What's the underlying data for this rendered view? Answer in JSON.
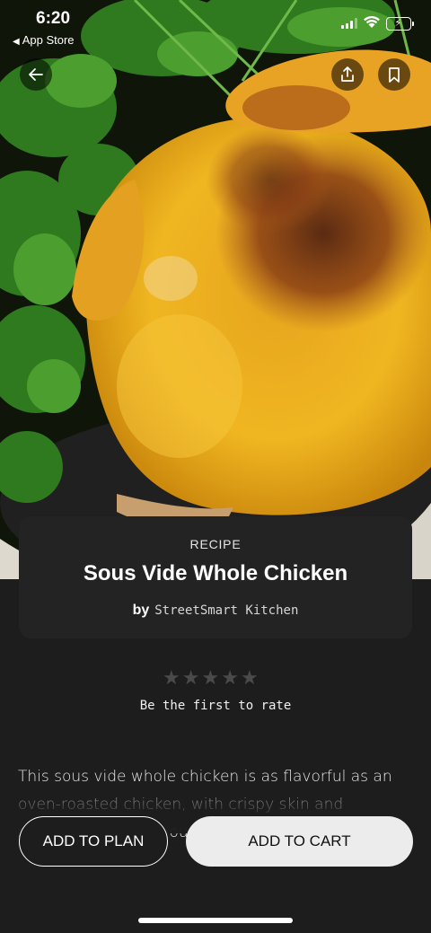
{
  "status_bar": {
    "time": "6:20",
    "back_to_app": "App Store"
  },
  "hero": {
    "image_subject": "roast-chicken-photo",
    "back_icon": "arrow-left-icon",
    "share_icon": "share-upload-icon",
    "save_icon": "bookmark-icon"
  },
  "recipe": {
    "kicker": "RECIPE",
    "title": "Sous Vide Whole Chicken",
    "by_label": "by",
    "author": "StreetSmart Kitchen"
  },
  "rating": {
    "stars_total": 5,
    "stars_filled": 0,
    "prompt": "Be the first to rate"
  },
  "description": {
    "text": "This sous vide whole chicken is as flavorful as an oven-roasted chicken, with crispy skin and succulent, melt-in-your-mouth meat throughout."
  },
  "actions": {
    "add_to_plan": "ADD TO PLAN",
    "add_to_cart": "ADD TO CART"
  },
  "colors": {
    "background": "#1d1d1d",
    "card": "#232323",
    "cart_button": "#ececec",
    "star_empty": "#4a4a4a"
  }
}
